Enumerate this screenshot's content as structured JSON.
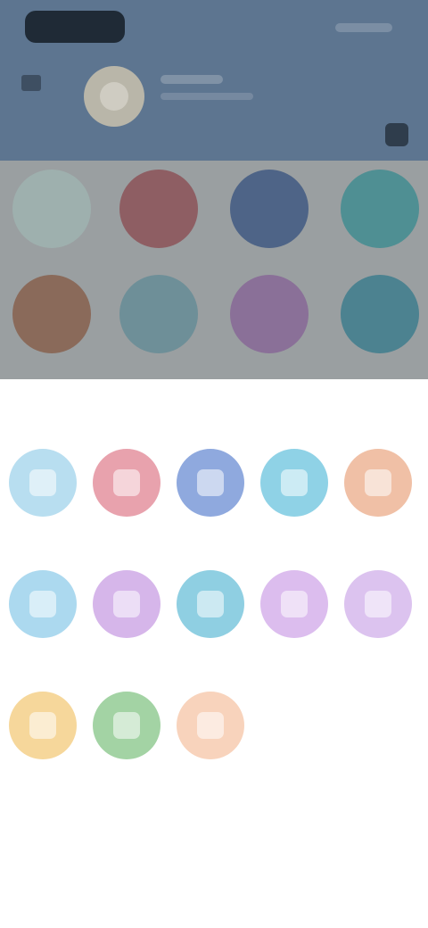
{
  "sheet": {
    "title": "",
    "actions": [
      {
        "label": "",
        "icon": "action-icon",
        "color": "#b8def0"
      },
      {
        "label": "",
        "icon": "action-icon",
        "color": "#e8a2ad"
      },
      {
        "label": "",
        "icon": "action-icon",
        "color": "#8fa9de"
      },
      {
        "label": "",
        "icon": "action-icon",
        "color": "#8fd2e6"
      },
      {
        "label": "",
        "icon": "action-icon",
        "color": "#f0c0a6"
      },
      {
        "label": "",
        "icon": "action-icon",
        "color": "#acd9ef"
      },
      {
        "label": "",
        "icon": "action-icon",
        "color": "#d6b6ea"
      },
      {
        "label": "",
        "icon": "action-icon",
        "color": "#8fcfe2"
      },
      {
        "label": "",
        "icon": "action-icon",
        "color": "#dcbdee"
      },
      {
        "label": "",
        "icon": "action-icon",
        "color": "#dcc3ef"
      },
      {
        "label": "",
        "icon": "action-icon",
        "color": "#f6d79b"
      },
      {
        "label": "",
        "icon": "action-icon",
        "color": "#a3d3a4"
      },
      {
        "label": "",
        "icon": "action-icon",
        "color": "#f8d3bc"
      }
    ],
    "manage_link": ""
  },
  "background": {
    "circle_colors": [
      "#9eb0ae",
      "#8e5e63",
      "#4e6487",
      "#4f8f93",
      "#8a6a5a",
      "#6e8f98",
      "#8a7098",
      "#4c8290"
    ]
  },
  "colors": {
    "sheet": "#ffffff",
    "header": "#5d7590",
    "link": "#6e95d8"
  }
}
